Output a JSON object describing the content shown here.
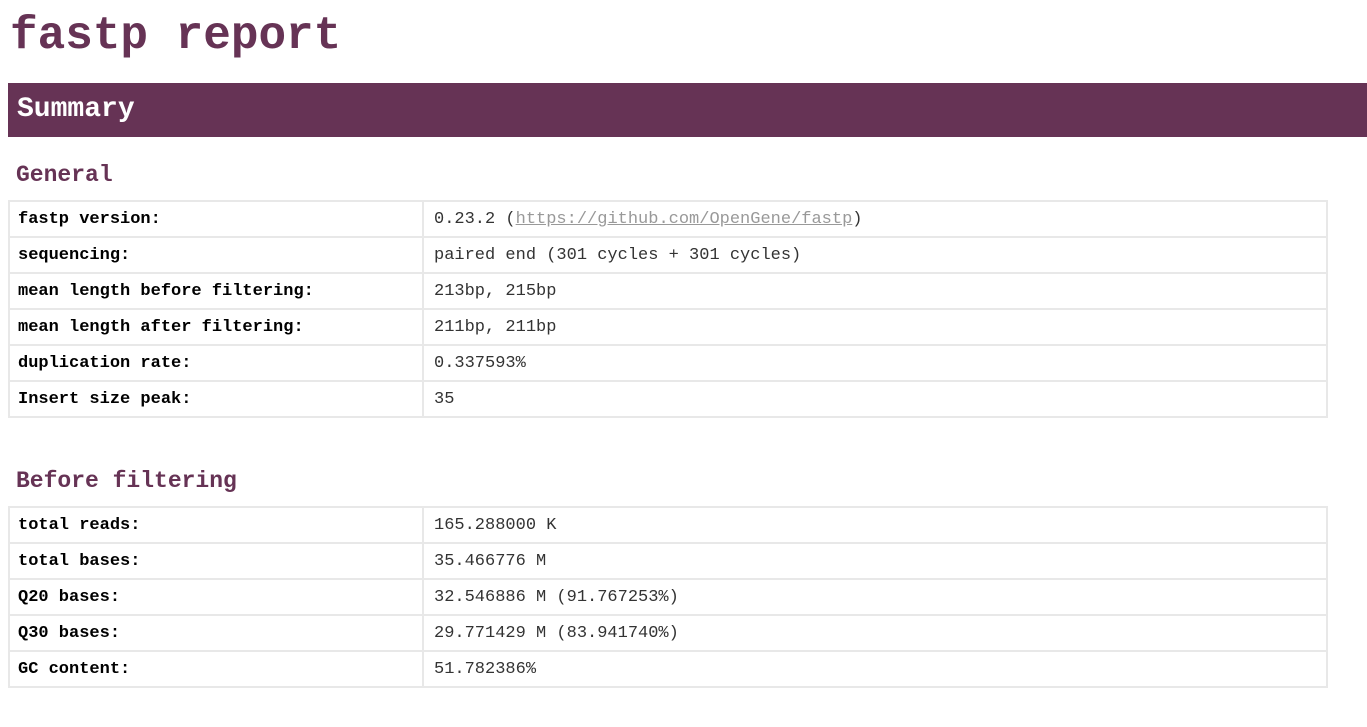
{
  "header": {
    "title": "fastp report"
  },
  "summary": {
    "banner": "Summary",
    "general": {
      "title": "General",
      "rows": [
        {
          "key": "fastp version:",
          "value_prefix": "0.23.2 (",
          "link": "https://github.com/OpenGene/fastp",
          "value_suffix": ")"
        },
        {
          "key": "sequencing:",
          "value": "paired end (301 cycles + 301 cycles)"
        },
        {
          "key": "mean length before filtering:",
          "value": "213bp, 215bp"
        },
        {
          "key": "mean length after filtering:",
          "value": "211bp, 211bp"
        },
        {
          "key": "duplication rate:",
          "value": "0.337593%"
        },
        {
          "key": "Insert size peak:",
          "value": "35"
        }
      ]
    },
    "before_filtering": {
      "title": "Before filtering",
      "rows": [
        {
          "key": "total reads:",
          "value": "165.288000 K"
        },
        {
          "key": "total bases:",
          "value": "35.466776 M"
        },
        {
          "key": "Q20 bases:",
          "value": "32.546886 M (91.767253%)"
        },
        {
          "key": "Q30 bases:",
          "value": "29.771429 M (83.941740%)"
        },
        {
          "key": "GC content:",
          "value": "51.782386%"
        }
      ]
    }
  },
  "colors": {
    "accent": "#663355",
    "link": "#999999",
    "border": "#e8e8e8"
  }
}
